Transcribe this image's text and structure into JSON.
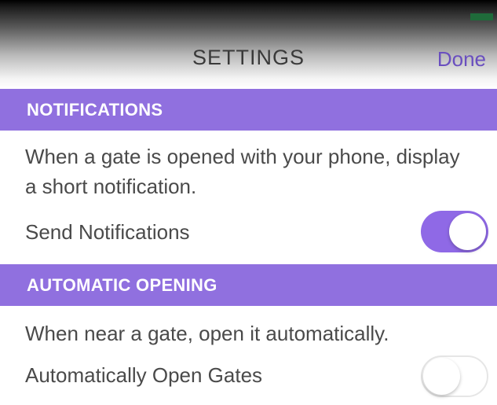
{
  "header": {
    "title": "SETTINGS",
    "done_label": "Done"
  },
  "sections": [
    {
      "title": "NOTIFICATIONS",
      "description": "When a gate is opened with your phone, display a short notification.",
      "setting_label": "Send Notifications",
      "toggle_on": true
    },
    {
      "title": "AUTOMATIC OPENING",
      "description": "When near a gate, open it automatically.",
      "setting_label": "Automatically Open Gates",
      "toggle_on": false
    }
  ],
  "colors": {
    "accent": "#9070df",
    "done_text": "#6a4fbf",
    "toggle_on": "#8f69e6",
    "status_indicator": "#1f6b3a"
  }
}
